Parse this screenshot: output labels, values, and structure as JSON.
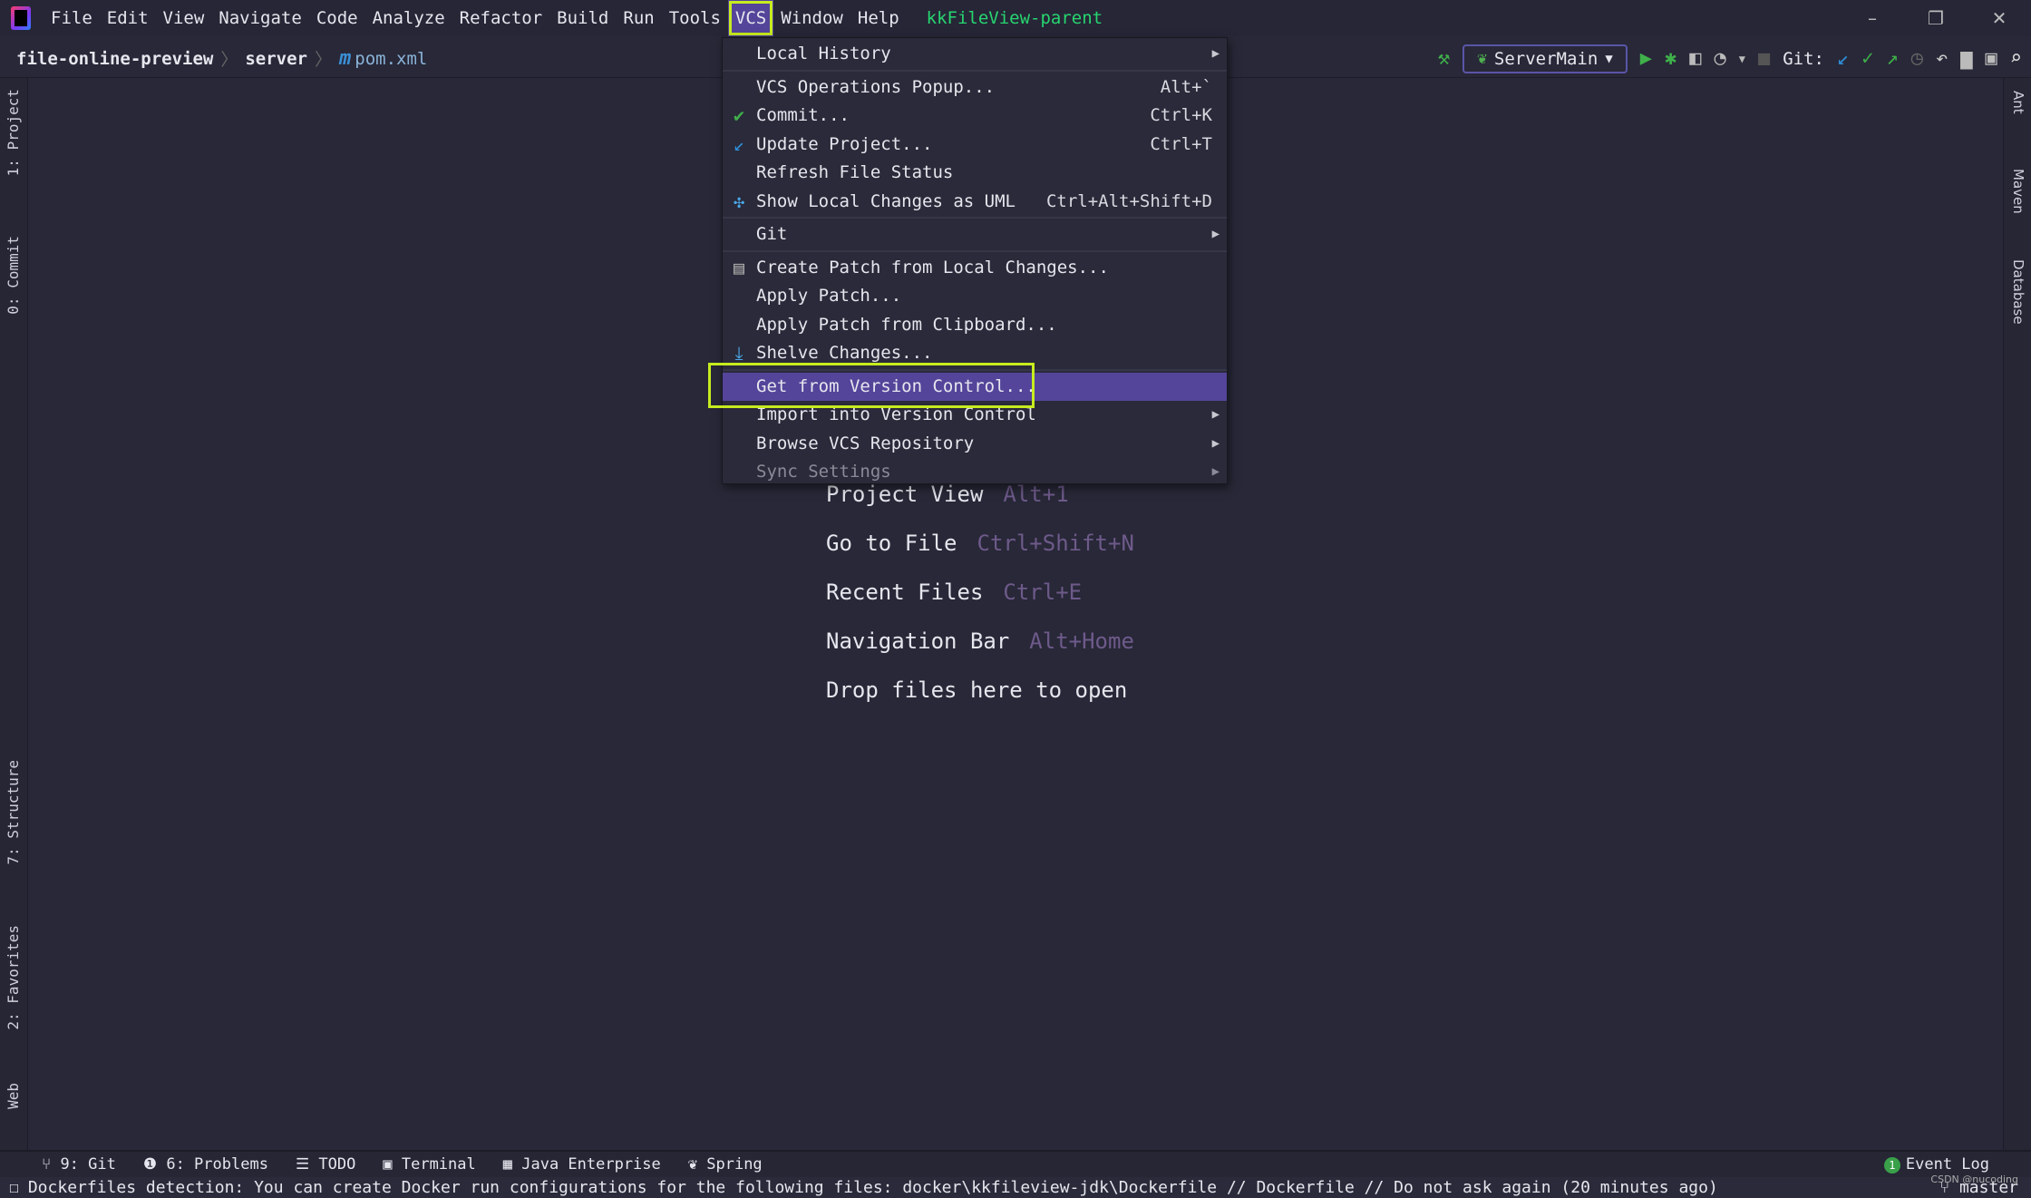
{
  "menubar": {
    "items": [
      "File",
      "Edit",
      "View",
      "Navigate",
      "Code",
      "Analyze",
      "Refactor",
      "Build",
      "Run",
      "Tools",
      "VCS",
      "Window",
      "Help"
    ],
    "active": "VCS",
    "project_title": "kkFileView-parent"
  },
  "breadcrumb": [
    "file-online-preview",
    "server",
    "pom.xml"
  ],
  "toolbar": {
    "run_config": "ServerMain",
    "git_label": "Git:"
  },
  "left_tabs": [
    "1: Project",
    "0: Commit",
    "7: Structure",
    "2: Favorites",
    "Web"
  ],
  "right_tabs": [
    "Ant",
    "Maven",
    "Database"
  ],
  "vcs_menu": [
    {
      "label": "Local History",
      "submenu": true
    },
    {
      "label": "VCS Operations Popup...",
      "shortcut": "Alt+`"
    },
    {
      "label": "Commit...",
      "shortcut": "Ctrl+K",
      "icon": "check-icon"
    },
    {
      "label": "Update Project...",
      "shortcut": "Ctrl+T",
      "icon": "update-arrow-icon"
    },
    {
      "label": "Refresh File Status"
    },
    {
      "label": "Show Local Changes as UML",
      "shortcut": "Ctrl+Alt+Shift+D",
      "icon": "uml-icon"
    },
    {
      "label": "Git",
      "submenu": true
    },
    {
      "label": "Create Patch from Local Changes...",
      "icon": "patch-icon"
    },
    {
      "label": "Apply Patch..."
    },
    {
      "label": "Apply Patch from Clipboard..."
    },
    {
      "label": "Shelve Changes...",
      "icon": "shelve-icon"
    },
    {
      "label": "Get from Version Control...",
      "selected": true
    },
    {
      "label": "Import into Version Control",
      "submenu": true
    },
    {
      "label": "Browse VCS Repository",
      "submenu": true
    },
    {
      "label": "Sync Settings",
      "submenu": true,
      "disabled": true
    }
  ],
  "welcome": [
    {
      "label": "Project View",
      "shortcut": "Alt+1"
    },
    {
      "label": "Go to File",
      "shortcut": "Ctrl+Shift+N"
    },
    {
      "label": "Recent Files",
      "shortcut": "Ctrl+E"
    },
    {
      "label": "Navigation Bar",
      "shortcut": "Alt+Home"
    },
    {
      "label": "Drop files here to open",
      "shortcut": ""
    }
  ],
  "tool_windows": [
    "9: Git",
    "6: Problems",
    "TODO",
    "Terminal",
    "Java Enterprise",
    "Spring"
  ],
  "event_log": {
    "label": "Event Log",
    "count": "1"
  },
  "status": {
    "message": "Dockerfiles detection: You can create Docker run configurations for the following files: docker\\kkfileview-jdk\\Dockerfile // Dockerfile // Do not ask again (20 minutes ago)",
    "branch": "master"
  },
  "watermark": "CSDN @nucoding",
  "colors": {
    "accent": "#54459a",
    "highlight_box": "#c6ec1e",
    "title": "#27d56f",
    "shortcut": "#6e5a8a"
  }
}
